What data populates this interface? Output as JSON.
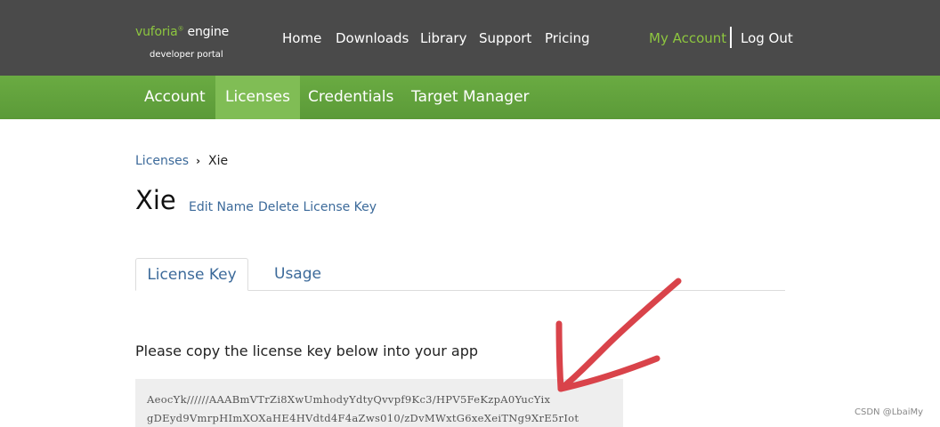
{
  "header": {
    "logo": {
      "brand": "vuforia",
      "reg": "®",
      "product": " engine",
      "subtitle": "developer portal"
    },
    "nav": [
      {
        "label": "Home"
      },
      {
        "label": "Downloads"
      },
      {
        "label": "Library"
      },
      {
        "label": "Support"
      },
      {
        "label": "Pricing"
      }
    ],
    "account_label": "My Account",
    "logout_label": "Log Out"
  },
  "subnav": {
    "items": [
      {
        "label": "Account"
      },
      {
        "label": "Licenses",
        "active": true
      },
      {
        "label": "Credentials"
      },
      {
        "label": "Target Manager"
      }
    ]
  },
  "breadcrumb": {
    "parent": "Licenses",
    "current": "Xie"
  },
  "license": {
    "name": "Xie",
    "edit_label": "Edit Name",
    "delete_label": "Delete License Key"
  },
  "tabs": [
    {
      "label": "License Key",
      "active": true
    },
    {
      "label": "Usage"
    }
  ],
  "instructions": "Please copy the license key below into your app",
  "license_key": {
    "line1": "AeocYk//////AAABmVTrZi8XwUmhodyYdtyQvvpf9Kc3/HPV5FeKzpA0YucYix",
    "line2": "gDEyd9VmrpHImXOXaHE4HVdtd4F4aZws010/zDvMWxtG6xeXeiTNg9XrE5rIot"
  },
  "annotation": {
    "arrow_color": "#d9434a"
  },
  "watermark": "CSDN @LbaiMy",
  "colors": {
    "topbar": "#4a4a4a",
    "subnav": "#5f9f3b",
    "accent_green": "#8dc63f",
    "link_blue": "#3c6a9a"
  }
}
